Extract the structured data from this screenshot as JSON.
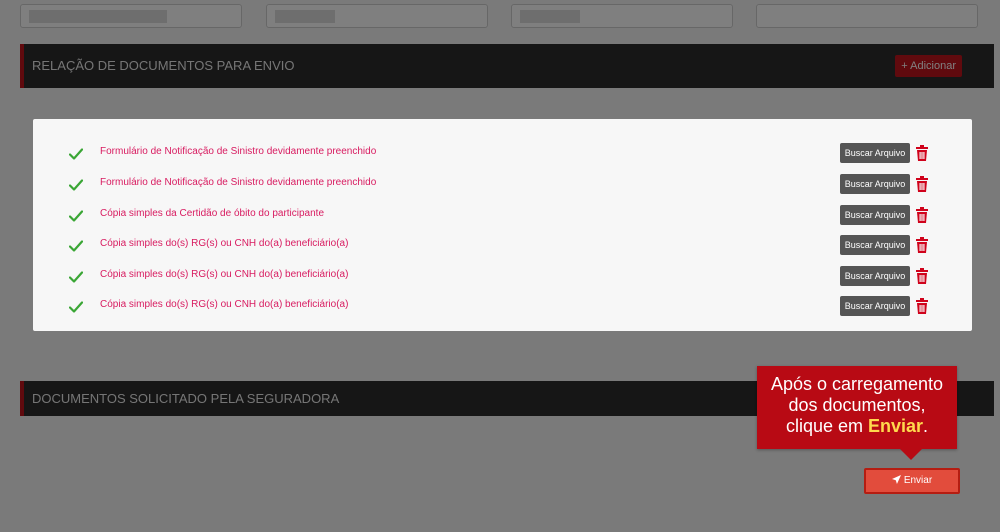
{
  "top_fields": [
    {},
    {},
    {},
    {}
  ],
  "sections": {
    "envio": {
      "title": "RELAÇÃO DE DOCUMENTOS PARA ENVIO",
      "add_label": "+ Adicionar"
    },
    "seguradora": {
      "title": "DOCUMENTOS SOLICITADO PELA SEGURADORA"
    }
  },
  "documents": [
    {
      "label": "Formulário de Notificação de Sinistro devidamente preenchido",
      "button": "Buscar Arquivo",
      "status_icon": "check-icon"
    },
    {
      "label": "Formulário de Notificação de Sinistro devidamente preenchido",
      "button": "Buscar Arquivo",
      "status_icon": "check-icon"
    },
    {
      "label": "Cópia simples da Certidão de óbito do participante",
      "button": "Buscar Arquivo",
      "status_icon": "check-icon"
    },
    {
      "label": "Cópia simples do(s) RG(s) ou CNH do(a) beneficiário(a)",
      "button": "Buscar Arquivo",
      "status_icon": "check-icon"
    },
    {
      "label": "Cópia simples do(s) RG(s) ou CNH do(a) beneficiário(a)",
      "button": "Buscar Arquivo",
      "status_icon": "check-icon"
    },
    {
      "label": "Cópia simples do(s) RG(s) ou CNH do(a) beneficiário(a)",
      "button": "Buscar Arquivo",
      "status_icon": "check-icon"
    }
  ],
  "tooltip": {
    "line1": "Após o carregamento",
    "line2": "dos documentos,",
    "line3_prefix": "clique em ",
    "line3_highlight": "Enviar",
    "line3_suffix": "."
  },
  "send_button": {
    "label": "Enviar",
    "icon": "paper-plane-icon"
  },
  "colors": {
    "accent": "#c0141c",
    "document_text": "#d81b60",
    "check": "#3aa635",
    "highlight": "#ffd84d"
  }
}
